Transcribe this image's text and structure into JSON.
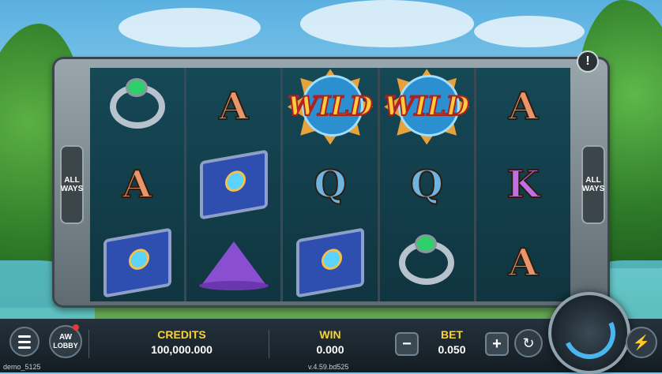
{
  "reels": [
    [
      "ring",
      "A",
      "book"
    ],
    [
      "A",
      "book",
      "hat"
    ],
    [
      "wild",
      "Q",
      "book"
    ],
    [
      "wild",
      "Q",
      "ring"
    ],
    [
      "A",
      "K",
      "A"
    ]
  ],
  "wild_text": "WILD",
  "side_plate": {
    "line1": "ALL",
    "line2": "WAYS"
  },
  "info_glyph": "!",
  "menu": {
    "lobby_label": "LOBBY",
    "lobby_logo": "AW"
  },
  "credits": {
    "label": "CREDITS",
    "value": "100,000.000"
  },
  "win": {
    "label": "WIN",
    "value": "0.000"
  },
  "bet": {
    "label": "BET",
    "value": "0.050",
    "minus": "−",
    "plus": "+"
  },
  "autoplay_glyph": "↻",
  "turbo_glyph": "⚡",
  "footer": {
    "user": "demo_5125",
    "version": "v.4.59.bd525"
  },
  "colors": {
    "accent": "#f7d23b",
    "spin_ring": "#49b6f0",
    "reel_bg": "#123c47"
  }
}
